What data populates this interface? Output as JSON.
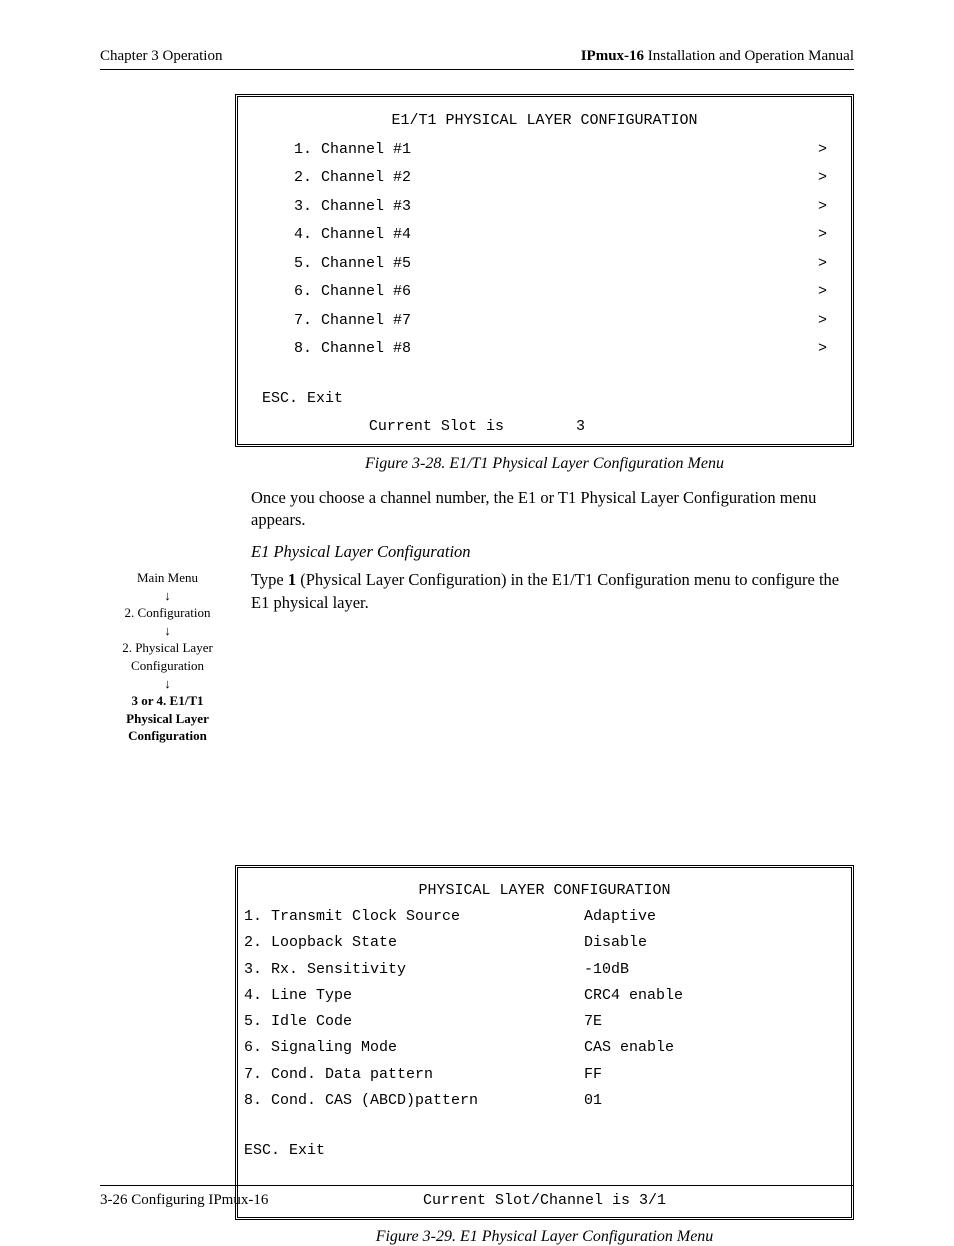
{
  "header": {
    "left": "Chapter 3  Operation",
    "right_bold": "IPmux-16",
    "right_rest": " Installation and Operation Manual"
  },
  "terminal1": {
    "title": "E1/T1 PHYSICAL LAYER CONFIGURATION",
    "rows": [
      {
        "num": "1.",
        "label": "Channel #1",
        "arrow": ">"
      },
      {
        "num": "2.",
        "label": "Channel #2",
        "arrow": ">"
      },
      {
        "num": "3.",
        "label": "Channel #3",
        "arrow": ">"
      },
      {
        "num": "4.",
        "label": "Channel #4",
        "arrow": ">"
      },
      {
        "num": "5.",
        "label": "Channel #5",
        "arrow": ">"
      },
      {
        "num": "6.",
        "label": "Channel #6",
        "arrow": ">"
      },
      {
        "num": "7.",
        "label": "Channel #7",
        "arrow": ">"
      },
      {
        "num": "8.",
        "label": "Channel #8",
        "arrow": ">"
      }
    ],
    "esc": "ESC. Exit",
    "status_label": "Current Slot is",
    "status_value": "3"
  },
  "caption1": "Figure 3-28.  E1/T1 Physical Layer Configuration Menu",
  "para1": "Once you choose a channel number, the E1 or T1 Physical Layer Configuration menu appears.",
  "subhead": "E1 Physical Layer Configuration",
  "para2_pre": "Type ",
  "para2_bold": "1",
  "para2_post": " (Physical Layer Configuration) in the E1/T1 Configuration menu to configure the E1 physical layer.",
  "navtrail": {
    "l1": "Main Menu",
    "a": "↓",
    "l2": "2. Configuration",
    "l3": "2. Physical Layer Configuration",
    "l4a": "3 or 4. E1/T1",
    "l4b": "Physical Layer",
    "l4c": "Configuration"
  },
  "terminal2": {
    "title": "PHYSICAL LAYER CONFIGURATION",
    "rows": [
      {
        "k": "1. Transmit Clock Source",
        "v": "Adaptive"
      },
      {
        "k": "2. Loopback State",
        "v": "Disable"
      },
      {
        "k": "3. Rx. Sensitivity",
        "v": "-10dB"
      },
      {
        "k": "4. Line Type",
        "v": "CRC4 enable"
      },
      {
        "k": "5. Idle Code",
        "v": "7E"
      },
      {
        "k": "6. Signaling Mode",
        "v": "CAS enable"
      },
      {
        "k": "7. Cond. Data pattern",
        "v": "FF"
      },
      {
        "k": "8. Cond. CAS (ABCD)pattern",
        "v": "01"
      }
    ],
    "esc": "ESC. Exit",
    "status": "Current Slot/Channel is 3/1"
  },
  "caption2": "Figure 3-29.  E1 Physical Layer Configuration Menu",
  "footer": "3-26 Configuring IPmux-16"
}
